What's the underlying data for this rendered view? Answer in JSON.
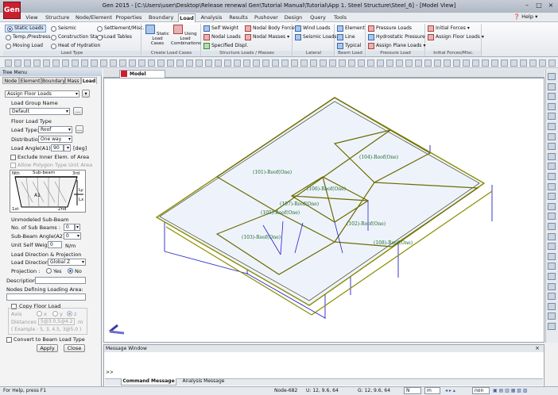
{
  "app": {
    "logo_text": "Gen",
    "title": "Gen 2015 - [C:\\Users\\user\\Desktop\\Release renewal Gen\\Tutorial Manual\\Tutorial\\App 1. Steel Structure\\Steel_6] - [Model View]"
  },
  "menu": {
    "tabs": [
      "View",
      "Structure",
      "Node/Element",
      "Properties",
      "Boundary",
      "Load",
      "Analysis",
      "Results",
      "Pushover",
      "Design",
      "Query",
      "Tools"
    ],
    "active": "Load",
    "help": "Help"
  },
  "ribbon": {
    "load_type": {
      "label": "Load Type",
      "items": [
        "Static Loads",
        "Seismic",
        "Settlement/Misc.",
        "Temp./Prestress",
        "Construction Stage",
        "Load Tables",
        "Moving Load",
        "Heat of Hydration"
      ]
    },
    "create_load_cases": {
      "label": "Create Load Cases",
      "static_cases": "Static Load Cases",
      "using_combinations": "Using Load Combinations"
    },
    "structure_loads": {
      "label": "Structure Loads / Masses",
      "items": [
        "Self Weight",
        "Nodal Body Force",
        "Nodal Loads",
        "Nodal Masses",
        "Specified Displ."
      ]
    },
    "lateral": {
      "label": "Lateral",
      "items": [
        "Wind Loads",
        "Seismic Loads"
      ]
    },
    "beam_load": {
      "label": "Beam Load",
      "items": [
        "Element",
        "Line",
        "Typical"
      ]
    },
    "pressure_load": {
      "label": "Pressure Load",
      "items": [
        "Pressure Loads",
        "Hydrostatic Pressure",
        "Assign Plane Loads"
      ]
    },
    "initial_forces": {
      "label": "Initial Forces/Misc.",
      "items": [
        "Initial Forces",
        "Assign Floor Loads"
      ]
    }
  },
  "tree_menu": {
    "title": "Tree Menu",
    "tabs": [
      "Node",
      "Element",
      "Boundary",
      "Mass",
      "Load"
    ],
    "active_tab": "Load",
    "command_select": "Assign Floor Loads",
    "load_group_name_label": "Load Group Name",
    "load_group_value": "Default",
    "floor_load_type_label": "Floor Load Type",
    "load_type_label": "Load Type:",
    "load_type_value": "Roof",
    "distribution_label": "Distribution:",
    "distribution_value": "One way",
    "load_angle_label": "Load Angle(A1):",
    "load_angle_value": "90",
    "load_angle_unit": "[deg]",
    "exclude_inner": "Exclude Inner Elem. of Area",
    "allow_polygon": "Allow Polygon Type Unit Area",
    "diagram": {
      "nth": "Nth",
      "sub_beam": "Sub-beam",
      "third": "3rd",
      "first": "1st",
      "second": "2nd",
      "a1": "A1",
      "lx": "Lx",
      "ly": "Ly"
    },
    "unmodeled_label": "Unmodeled Sub-Beam",
    "no_sub_beams_label": "No. of Sub Beams :",
    "no_sub_beams_value": "0",
    "sub_beam_angle_label": "Sub-Beam Angle(A2):",
    "sub_beam_angle_value": "0",
    "unit_self_weight_label": "Unit Self Weight:",
    "unit_self_weight_value": "0",
    "unit_self_weight_unit": "N/m",
    "load_direction_label": "Load Direction & Projection",
    "load_direction_field_label": "Load Direction :",
    "load_direction_value": "Global Z",
    "projection_label": "Projection :",
    "projection_yes": "Yes",
    "projection_no": "No",
    "description_label": "Description:",
    "nodes_defining_label": "Nodes Defining Loading Area:",
    "copy_floor_load": "Copy Floor Load",
    "axis_label": "Axis",
    "axis_x": "x",
    "axis_y": "y",
    "axis_z": "z",
    "distances_label": "Distances :",
    "distances_value": "5@3.0,5@4.2",
    "distances_unit": "m",
    "example": "( Example :  5, 3, 4.5, 3@5.0 )",
    "convert_beam": "Convert to Beam Load Type",
    "apply": "Apply",
    "close": "Close"
  },
  "view": {
    "tab_label": "Model View",
    "labels": [
      "(101)-Roof(One)",
      "(104)-Roof(One)",
      "(106)-Roof(One)",
      "(107)-Roof(One)",
      "(105)-Roof(One)",
      "(103)-Roof(One)",
      "(102)-Roof(One)",
      "(108)-Roof(One)"
    ]
  },
  "messages": {
    "title": "Message Window",
    "prompt": ">>",
    "tabs": [
      "Command Message",
      "Analysis Message"
    ]
  },
  "status": {
    "help_text": "For Help, press F1",
    "node": "Node-682",
    "u": "U: 12, 9.6, 64",
    "g": "G: 12, 9.6, 64",
    "force_unit": "N",
    "length_unit": "m",
    "none": "non"
  }
}
